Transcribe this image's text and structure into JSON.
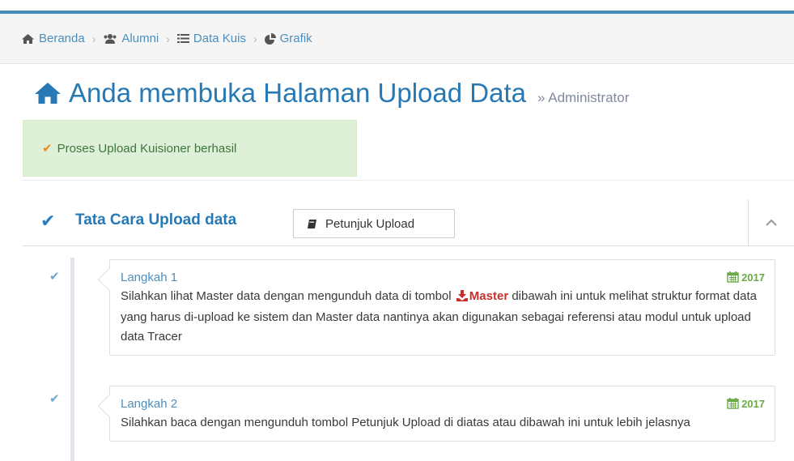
{
  "breadcrumbs": [
    {
      "label": "Beranda",
      "icon": "home-icon"
    },
    {
      "label": "Alumni",
      "icon": "users-icon"
    },
    {
      "label": "Data Kuis",
      "icon": "list-icon"
    },
    {
      "label": "Grafik",
      "icon": "pie-chart-icon"
    }
  ],
  "header": {
    "title": "Anda membuka Halaman Upload Data",
    "subtitle": "» Administrator"
  },
  "alert": {
    "message": "Proses Upload Kuisioner berhasil"
  },
  "widget": {
    "title": "Tata Cara Upload data",
    "button_label": "Petunjuk Upload"
  },
  "steps": [
    {
      "label": "Langkah 1",
      "year": "2017",
      "text_before": "Silahkan lihat Master data dengan mengunduh data di tombol",
      "master_label": "Master",
      "text_after": "dibawah ini untuk melihat struktur format data yang harus di-upload ke sistem dan Master data nantinya akan digunakan sebagai referensi atau modul untuk upload data Tracer"
    },
    {
      "label": "Langkah 2",
      "year": "2017",
      "text": "Silahkan baca dengan mengunduh tombol Petunjuk Upload di diatas atau dibawah ini untuk lebih jelasnya"
    }
  ],
  "colors": {
    "accent": "#438eb9",
    "title_blue": "#2679b5",
    "link_blue": "#4c8fbd",
    "success_bg": "#dff0d8",
    "success_text": "#3c763d",
    "year_green": "#69aa46",
    "master_red": "#c9302c"
  }
}
